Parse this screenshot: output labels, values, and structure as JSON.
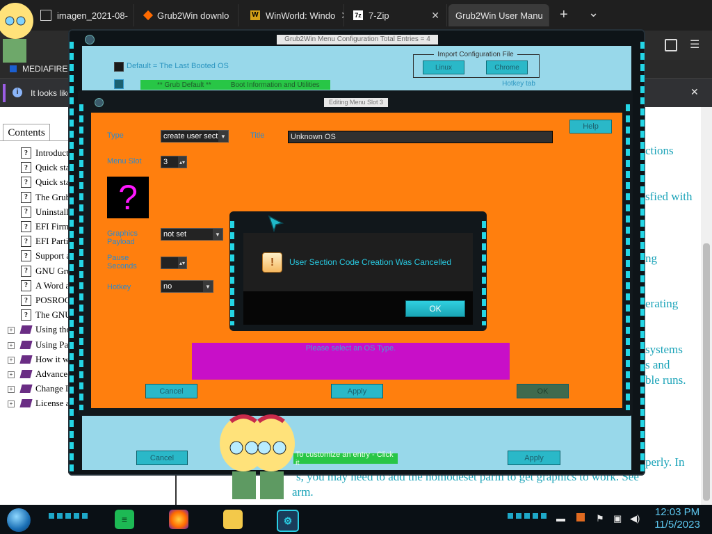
{
  "browser": {
    "tabs": [
      {
        "label": "imagen_2021-08-",
        "icon": "document-icon"
      },
      {
        "label": "Grub2Win downlo",
        "icon": "sourceforge-icon"
      },
      {
        "label": "WinWorld: Windo",
        "icon": "winworld-icon"
      },
      {
        "label": "7-Zip",
        "icon": "7zip-icon"
      },
      {
        "label": "Grub2Win User Manu",
        "icon": "none",
        "active": true
      }
    ],
    "new_tab": "+",
    "tab_list": "⌄",
    "bookmark": "MEDIAFIRE F",
    "infobar_text": "It looks like",
    "infobar_close": "✕"
  },
  "doc": {
    "contents_tab": "Contents",
    "toc": [
      {
        "label": "Introducti",
        "kind": "page"
      },
      {
        "label": "Quick sta",
        "kind": "page"
      },
      {
        "label": "Quick sta",
        "kind": "page"
      },
      {
        "label": "The Grub",
        "kind": "page"
      },
      {
        "label": "Uninstalli",
        "kind": "page"
      },
      {
        "label": "EFI Firm",
        "kind": "page"
      },
      {
        "label": "EFI Partit",
        "kind": "page"
      },
      {
        "label": "Support a",
        "kind": "page"
      },
      {
        "label": "GNU Gru",
        "kind": "page"
      },
      {
        "label": "A Word a",
        "kind": "page"
      },
      {
        "label": "POSROG",
        "kind": "page"
      },
      {
        "label": "The GNU",
        "kind": "page"
      },
      {
        "label": "Using the",
        "kind": "book"
      },
      {
        "label": "Using Par",
        "kind": "book"
      },
      {
        "label": "How it w",
        "kind": "book"
      },
      {
        "label": "Advanced",
        "kind": "book"
      },
      {
        "label": "Change L",
        "kind": "book"
      },
      {
        "label": "License a",
        "kind": "book"
      }
    ],
    "right_text": [
      "ctions",
      "sfied with",
      "ng",
      "erating",
      "systems",
      "s and",
      "ble runs.",
      "perly. In"
    ],
    "bottom_line1": "s, you may need to add the nomodeset parm to get graphics to work. See",
    "bottom_line2": "arm."
  },
  "grub_bg": {
    "title": "Grub2Win Menu Configuration    Total Entries = 4",
    "default_label": "Default = The Last Booted OS",
    "import_title": "Import Configuration File",
    "import_linux": "Linux",
    "import_chrome": "Chrome",
    "grub_default": "** Grub Default **",
    "boot_info": "Boot Information and Utilities",
    "hotkey_tab": "Hotkey tab",
    "cancel": "Cancel",
    "customize_hint": "To customize an entry - Click it",
    "apply": "Apply"
  },
  "edit": {
    "title": "Editing Menu Slot 3",
    "type_label": "Type",
    "type_value": "create user secti",
    "title_label": "Title",
    "title_value": "Unknown OS",
    "help": "Help",
    "menu_slot_label": "Menu Slot",
    "menu_slot_value": "3",
    "os_icon": "?",
    "graphics_label_1": "Graphics",
    "graphics_label_2": "Payload",
    "graphics_value": "not set",
    "pause_label_1": "Pause",
    "pause_label_2": "Seconds",
    "pause_value": "",
    "hotkey_label": "Hotkey",
    "hotkey_value": "no",
    "status": "Please select an OS Type.",
    "cancel": "Cancel",
    "apply": "Apply",
    "ok": "OK"
  },
  "message": {
    "text": "User Section Code Creation Was Cancelled",
    "icon": "!",
    "ok": "OK"
  },
  "taskbar": {
    "time": "12:03 PM",
    "date": "11/5/2023",
    "apps": [
      "start-orb",
      "spreadsheet-app",
      "firefox",
      "file-explorer",
      "grub2win"
    ]
  },
  "colors": {
    "orange": "#ff7f0e",
    "cyan": "#2ab8c8",
    "magenta": "#c80fc8",
    "lightblue": "#98d8ea",
    "green": "#28c646"
  }
}
